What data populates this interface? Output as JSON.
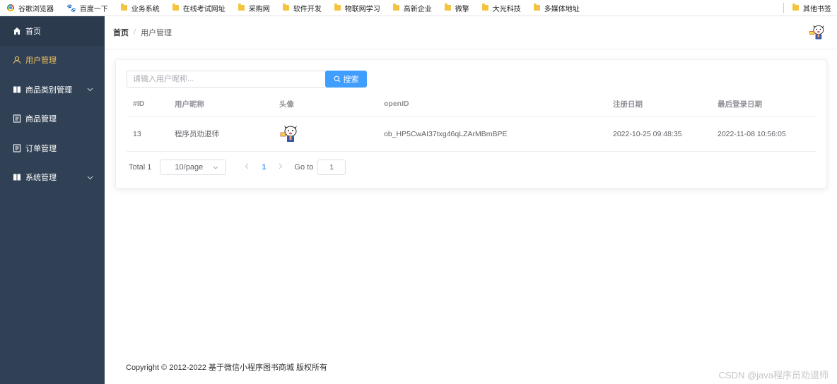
{
  "bookmarks": [
    {
      "label": "谷歌浏览器",
      "icon": "chrome-icon"
    },
    {
      "label": "百度一下",
      "icon": "baidu-paw-icon"
    },
    {
      "label": "业务系统",
      "icon": "folder-icon"
    },
    {
      "label": "在线考试网址",
      "icon": "folder-icon"
    },
    {
      "label": "采购网",
      "icon": "folder-icon"
    },
    {
      "label": "软件开发",
      "icon": "folder-icon"
    },
    {
      "label": "物联网学习",
      "icon": "folder-icon"
    },
    {
      "label": "高新企业",
      "icon": "folder-icon"
    },
    {
      "label": "微擎",
      "icon": "folder-icon"
    },
    {
      "label": "大光科技",
      "icon": "folder-icon"
    },
    {
      "label": "多媒体地址",
      "icon": "folder-icon"
    }
  ],
  "other_bookmarks": "其他书签",
  "sidebar": {
    "items": [
      {
        "label": "首页",
        "icon": "home-icon"
      },
      {
        "label": "用户管理",
        "icon": "user-icon"
      },
      {
        "label": "商品类别管理",
        "icon": "book-icon"
      },
      {
        "label": "商品管理",
        "icon": "document-icon"
      },
      {
        "label": "订单管理",
        "icon": "document-icon"
      },
      {
        "label": "系统管理",
        "icon": "book-icon"
      }
    ]
  },
  "breadcrumb": {
    "home": "首页",
    "separator": "/",
    "current": "用户管理"
  },
  "search": {
    "placeholder": "请输入用户昵称...",
    "value": "",
    "button_label": "搜索"
  },
  "table": {
    "columns": [
      "#ID",
      "用户昵称",
      "头像",
      "openID",
      "注册日期",
      "最后登录日期"
    ],
    "rows": [
      {
        "id": "13",
        "nickname": "程序员劝退师",
        "avatar": "avatar-image",
        "openid": "ob_HP5CwAI37txg46qLZArMBmBPE",
        "register_date": "2022-10-25 09:48:35",
        "last_login": "2022-11-08 10:56:05"
      }
    ]
  },
  "pagination": {
    "total": "Total 1",
    "page_size": "10/page",
    "current_page": "1",
    "goto_label": "Go to",
    "goto_value": "1"
  },
  "footer": "Copyright © 2012-2022 基于微信小程序图书商城 版权所有",
  "watermark": "CSDN @java程序员劝退师",
  "colors": {
    "sidebar_bg": "#304156",
    "active_menu": "#f7c35f",
    "primary": "#409eff"
  }
}
